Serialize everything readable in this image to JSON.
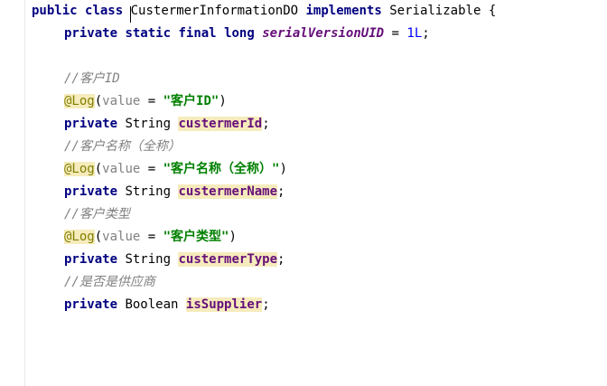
{
  "code": {
    "class_decl": {
      "kw_public": "public",
      "kw_class": "class",
      "class_name_first": "C",
      "class_name_rest": "ustermerInformationDO",
      "kw_implements": "implements",
      "interface": "Serializable",
      "brace": "{"
    },
    "serial": {
      "kw_private": "private",
      "kw_static": "static",
      "kw_final": "final",
      "kw_long": "long",
      "name": "serialVersionUID",
      "eq": "=",
      "value": "1L",
      "semi": ";"
    },
    "fields": [
      {
        "comment": "//客户ID",
        "annotation": "@Log",
        "paren_open": "(",
        "attr": "value",
        "eq": " = ",
        "str": "\"客户ID\"",
        "paren_close": ")",
        "kw_private": "private",
        "type": "String",
        "name": "custermerId",
        "semi": ";"
      },
      {
        "comment": "//客户名称（全称）",
        "annotation": "@Log",
        "paren_open": "(",
        "attr": "value",
        "eq": " = ",
        "str": "\"客户名称（全称）\"",
        "paren_close": ")",
        "kw_private": "private",
        "type": "String",
        "name": "custermerName",
        "semi": ";"
      },
      {
        "comment": "//客户类型",
        "annotation": "@Log",
        "paren_open": "(",
        "attr": "value",
        "eq": " = ",
        "str": "\"客户类型\"",
        "paren_close": ")",
        "kw_private": "private",
        "type": "String",
        "name": "custermerType",
        "semi": ";"
      }
    ],
    "last_field": {
      "comment": "//是否是供应商",
      "kw_private": "private",
      "type": "Boolean",
      "name": "isSupplier",
      "semi": ";"
    },
    "colors": {
      "keyword": "#000080",
      "static_field": "#660e7a",
      "number": "#0000ff",
      "comment": "#808080",
      "annotation": "#808000",
      "string": "#008000",
      "highlight": "#f6ebbc"
    }
  }
}
